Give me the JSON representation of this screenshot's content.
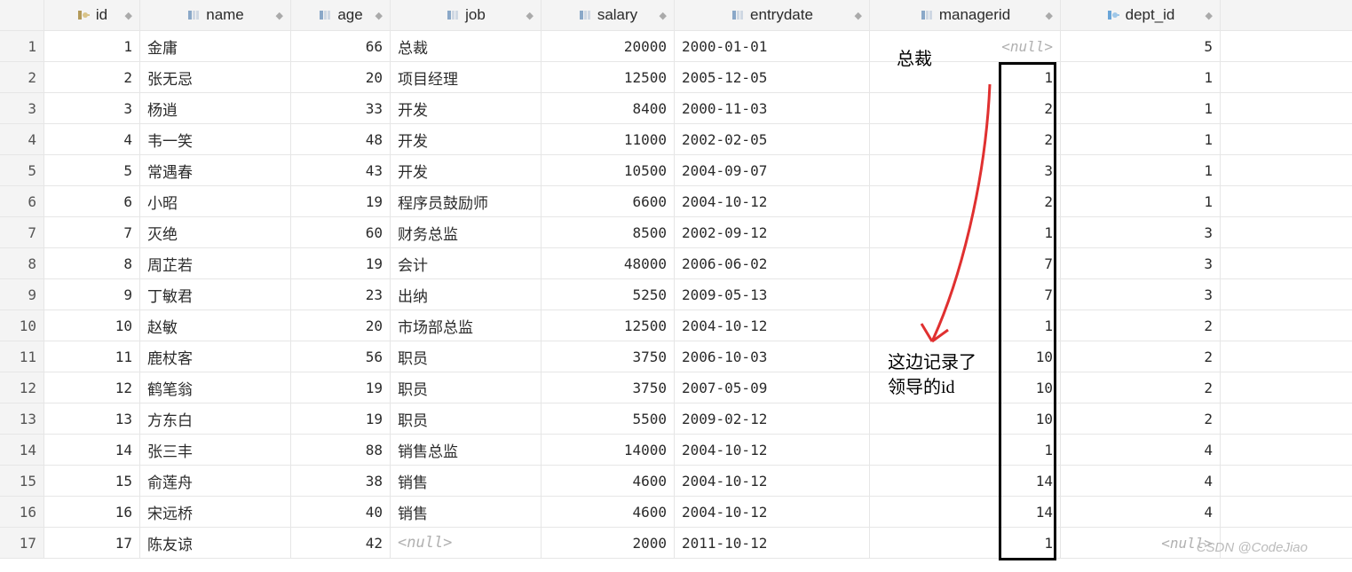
{
  "columns": {
    "id": "id",
    "name": "name",
    "age": "age",
    "job": "job",
    "salary": "salary",
    "entrydate": "entrydate",
    "managerid": "managerid",
    "dept_id": "dept_id"
  },
  "null_text": "<null>",
  "rows": [
    {
      "n": "1",
      "id": "1",
      "name": "金庸",
      "age": "66",
      "job": "总裁",
      "salary": "20000",
      "entrydate": "2000-01-01",
      "managerid": null,
      "dept_id": "5"
    },
    {
      "n": "2",
      "id": "2",
      "name": "张无忌",
      "age": "20",
      "job": "项目经理",
      "salary": "12500",
      "entrydate": "2005-12-05",
      "managerid": "1",
      "dept_id": "1"
    },
    {
      "n": "3",
      "id": "3",
      "name": "杨逍",
      "age": "33",
      "job": "开发",
      "salary": "8400",
      "entrydate": "2000-11-03",
      "managerid": "2",
      "dept_id": "1"
    },
    {
      "n": "4",
      "id": "4",
      "name": "韦一笑",
      "age": "48",
      "job": "开发",
      "salary": "11000",
      "entrydate": "2002-02-05",
      "managerid": "2",
      "dept_id": "1"
    },
    {
      "n": "5",
      "id": "5",
      "name": "常遇春",
      "age": "43",
      "job": "开发",
      "salary": "10500",
      "entrydate": "2004-09-07",
      "managerid": "3",
      "dept_id": "1"
    },
    {
      "n": "6",
      "id": "6",
      "name": "小昭",
      "age": "19",
      "job": "程序员鼓励师",
      "salary": "6600",
      "entrydate": "2004-10-12",
      "managerid": "2",
      "dept_id": "1"
    },
    {
      "n": "7",
      "id": "7",
      "name": "灭绝",
      "age": "60",
      "job": "财务总监",
      "salary": "8500",
      "entrydate": "2002-09-12",
      "managerid": "1",
      "dept_id": "3"
    },
    {
      "n": "8",
      "id": "8",
      "name": "周芷若",
      "age": "19",
      "job": "会计",
      "salary": "48000",
      "entrydate": "2006-06-02",
      "managerid": "7",
      "dept_id": "3"
    },
    {
      "n": "9",
      "id": "9",
      "name": "丁敏君",
      "age": "23",
      "job": "出纳",
      "salary": "5250",
      "entrydate": "2009-05-13",
      "managerid": "7",
      "dept_id": "3"
    },
    {
      "n": "10",
      "id": "10",
      "name": "赵敏",
      "age": "20",
      "job": "市场部总监",
      "salary": "12500",
      "entrydate": "2004-10-12",
      "managerid": "1",
      "dept_id": "2"
    },
    {
      "n": "11",
      "id": "11",
      "name": "鹿杖客",
      "age": "56",
      "job": "职员",
      "salary": "3750",
      "entrydate": "2006-10-03",
      "managerid": "10",
      "dept_id": "2"
    },
    {
      "n": "12",
      "id": "12",
      "name": "鹤笔翁",
      "age": "19",
      "job": "职员",
      "salary": "3750",
      "entrydate": "2007-05-09",
      "managerid": "10",
      "dept_id": "2"
    },
    {
      "n": "13",
      "id": "13",
      "name": "方东白",
      "age": "19",
      "job": "职员",
      "salary": "5500",
      "entrydate": "2009-02-12",
      "managerid": "10",
      "dept_id": "2"
    },
    {
      "n": "14",
      "id": "14",
      "name": "张三丰",
      "age": "88",
      "job": "销售总监",
      "salary": "14000",
      "entrydate": "2004-10-12",
      "managerid": "1",
      "dept_id": "4"
    },
    {
      "n": "15",
      "id": "15",
      "name": "俞莲舟",
      "age": "38",
      "job": "销售",
      "salary": "4600",
      "entrydate": "2004-10-12",
      "managerid": "14",
      "dept_id": "4"
    },
    {
      "n": "16",
      "id": "16",
      "name": "宋远桥",
      "age": "40",
      "job": "销售",
      "salary": "4600",
      "entrydate": "2004-10-12",
      "managerid": "14",
      "dept_id": "4"
    },
    {
      "n": "17",
      "id": "17",
      "name": "陈友谅",
      "age": "42",
      "job": null,
      "salary": "2000",
      "entrydate": "2011-10-12",
      "managerid": "1",
      "dept_id": null
    }
  ],
  "annotations": {
    "a1": "总裁",
    "a2": "这边记录了领导的id"
  },
  "watermark": "CSDN @CodeJiao"
}
